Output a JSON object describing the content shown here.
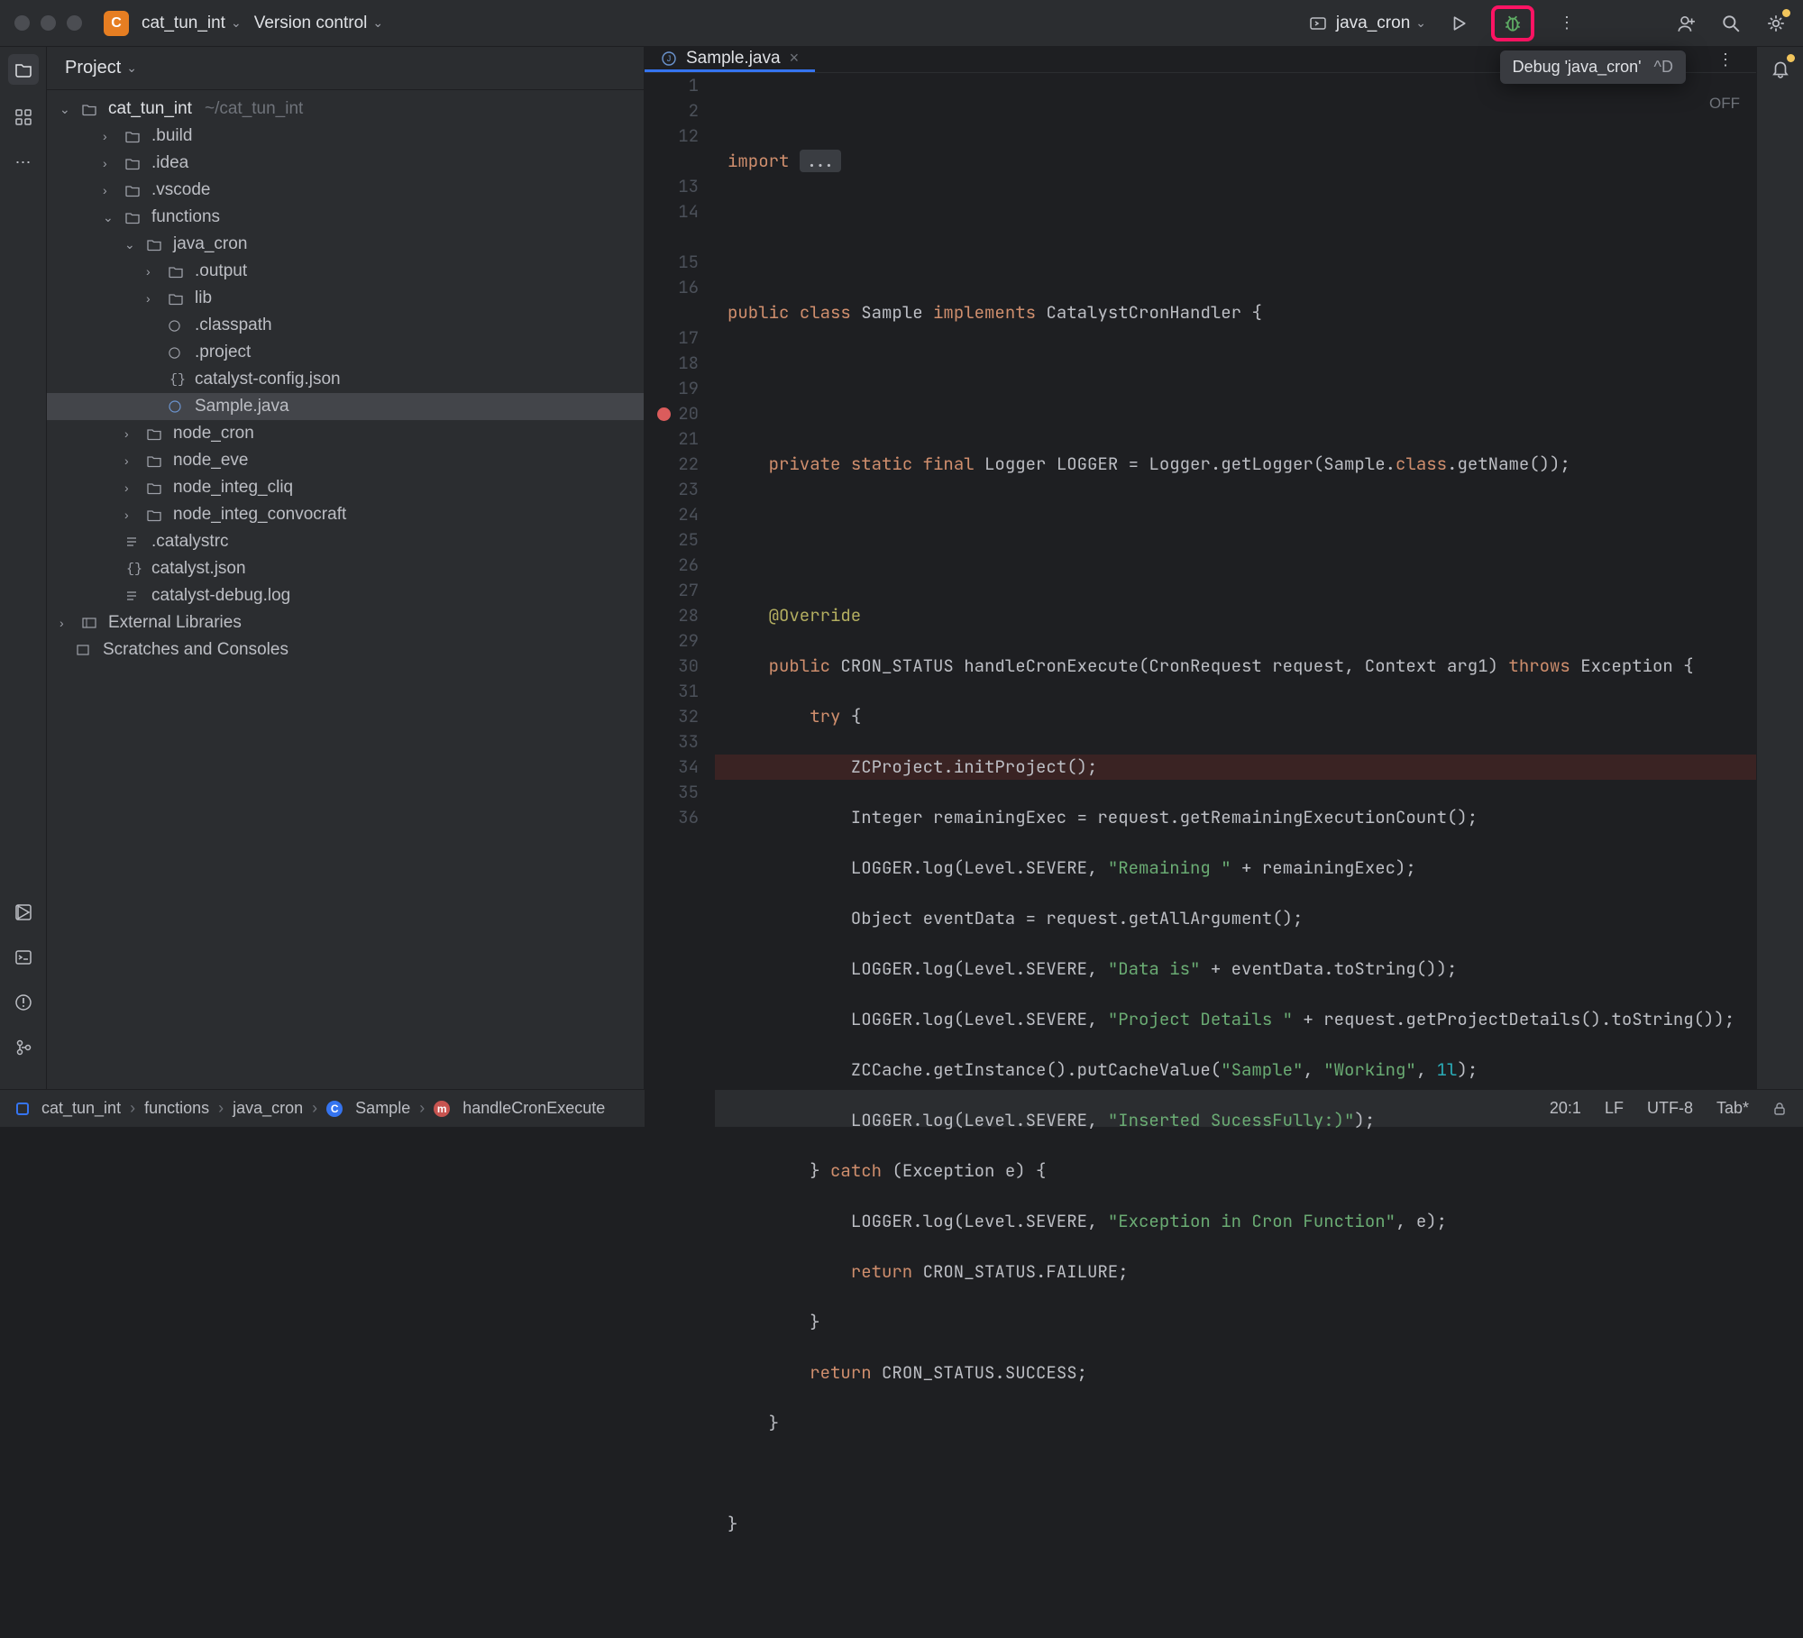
{
  "titlebar": {
    "project_initial": "C",
    "project_name": "cat_tun_int",
    "vcs_label": "Version control",
    "run_config": "java_cron"
  },
  "tooltip": {
    "text": "Debug 'java_cron'",
    "shortcut": "^D"
  },
  "sidebar": {
    "title": "Project",
    "root": {
      "name": "cat_tun_int",
      "path": "~/cat_tun_int"
    },
    "items": [
      {
        "name": ".build",
        "indent": 2,
        "toggle": "›",
        "icon": "folder"
      },
      {
        "name": ".idea",
        "indent": 2,
        "toggle": "›",
        "icon": "folder"
      },
      {
        "name": ".vscode",
        "indent": 2,
        "toggle": "›",
        "icon": "folder"
      },
      {
        "name": "functions",
        "indent": 2,
        "toggle": "⌄",
        "icon": "folder"
      },
      {
        "name": "java_cron",
        "indent": 3,
        "toggle": "⌄",
        "icon": "folder"
      },
      {
        "name": ".output",
        "indent": 4,
        "toggle": "›",
        "icon": "folder"
      },
      {
        "name": "lib",
        "indent": 4,
        "toggle": "›",
        "icon": "folder"
      },
      {
        "name": ".classpath",
        "indent": 4,
        "toggle": "",
        "icon": "file-c"
      },
      {
        "name": ".project",
        "indent": 4,
        "toggle": "",
        "icon": "file-c"
      },
      {
        "name": "catalyst-config.json",
        "indent": 4,
        "toggle": "",
        "icon": "json"
      },
      {
        "name": "Sample.java",
        "indent": 4,
        "toggle": "",
        "icon": "java",
        "selected": true
      },
      {
        "name": "node_cron",
        "indent": 3,
        "toggle": "›",
        "icon": "folder"
      },
      {
        "name": "node_eve",
        "indent": 3,
        "toggle": "›",
        "icon": "folder"
      },
      {
        "name": "node_integ_cliq",
        "indent": 3,
        "toggle": "›",
        "icon": "folder"
      },
      {
        "name": "node_integ_convocraft",
        "indent": 3,
        "toggle": "›",
        "icon": "folder"
      },
      {
        "name": ".catalystrc",
        "indent": 2,
        "toggle": "",
        "icon": "text"
      },
      {
        "name": "catalyst.json",
        "indent": 2,
        "toggle": "",
        "icon": "json"
      },
      {
        "name": "catalyst-debug.log",
        "indent": 2,
        "toggle": "",
        "icon": "text"
      }
    ],
    "external_libs": "External Libraries",
    "scratches": "Scratches and Consoles"
  },
  "editor": {
    "tab_name": "Sample.java",
    "off_label": "OFF",
    "line_numbers": [
      "1",
      "2",
      "12",
      "",
      "13",
      "14",
      "",
      "15",
      "16",
      "",
      "17",
      "18",
      "19",
      "20",
      "21",
      "22",
      "23",
      "24",
      "25",
      "26",
      "27",
      "28",
      "29",
      "30",
      "31",
      "32",
      "33",
      "34",
      "35",
      "36"
    ],
    "breakpoint_line": "20",
    "code": {
      "l2": "import ",
      "l2_fold": "...",
      "l13_1": "public ",
      "l13_2": "class ",
      "l13_3": "Sample ",
      "l13_4": "implements ",
      "l13_5": "CatalystCronHandler {",
      "l15_1": "    private ",
      "l15_2": "static ",
      "l15_3": "final ",
      "l15_4": "Logger LOGGER = Logger.getLogger(Sample.",
      "l15_5": "class",
      "l15_6": ".getName());",
      "l17": "    @Override",
      "l18_1": "    public ",
      "l18_2": "CRON_STATUS handleCronExecute(CronRequest request, Context arg1) ",
      "l18_3": "throws ",
      "l18_4": "Exception {",
      "l19_1": "        try ",
      "l19_2": "{",
      "l20": "            ZCProject.initProject();",
      "l21": "            Integer remainingExec = request.getRemainingExecutionCount();",
      "l22_1": "            LOGGER.log(Level.SEVERE, ",
      "l22_2": "\"Remaining \"",
      "l22_3": " + remainingExec);",
      "l23": "            Object eventData = request.getAllArgument();",
      "l24_1": "            LOGGER.log(Level.SEVERE, ",
      "l24_2": "\"Data is\"",
      "l24_3": " + eventData.toString());",
      "l25_1": "            LOGGER.log(Level.SEVERE, ",
      "l25_2": "\"Project Details \"",
      "l25_3": " + request.getProjectDetails().toString());",
      "l26_1": "            ZCCache.getInstance().putCacheValue(",
      "l26_2": "\"Sample\"",
      "l26_3": ", ",
      "l26_4": "\"Working\"",
      "l26_5": ", ",
      "l26_6": "1l",
      "l26_7": ");",
      "l27_1": "            LOGGER.log(Level.SEVERE, ",
      "l27_2": "\"Inserted SucessFully:)\"",
      "l27_3": ");",
      "l28_1": "        } ",
      "l28_2": "catch ",
      "l28_3": "(Exception e) {",
      "l29_1": "            LOGGER.log(Level.SEVERE, ",
      "l29_2": "\"Exception in Cron Function\"",
      "l29_3": ", e);",
      "l30_1": "            return ",
      "l30_2": "CRON_STATUS.FAILURE;",
      "l31": "        }",
      "l32_1": "        return ",
      "l32_2": "CRON_STATUS.SUCCESS;",
      "l33": "    }",
      "l35": "}"
    }
  },
  "statusbar": {
    "crumbs": [
      "cat_tun_int",
      "functions",
      "java_cron",
      "Sample",
      "handleCronExecute"
    ],
    "position": "20:1",
    "line_sep": "LF",
    "encoding": "UTF-8",
    "indent": "Tab*"
  }
}
